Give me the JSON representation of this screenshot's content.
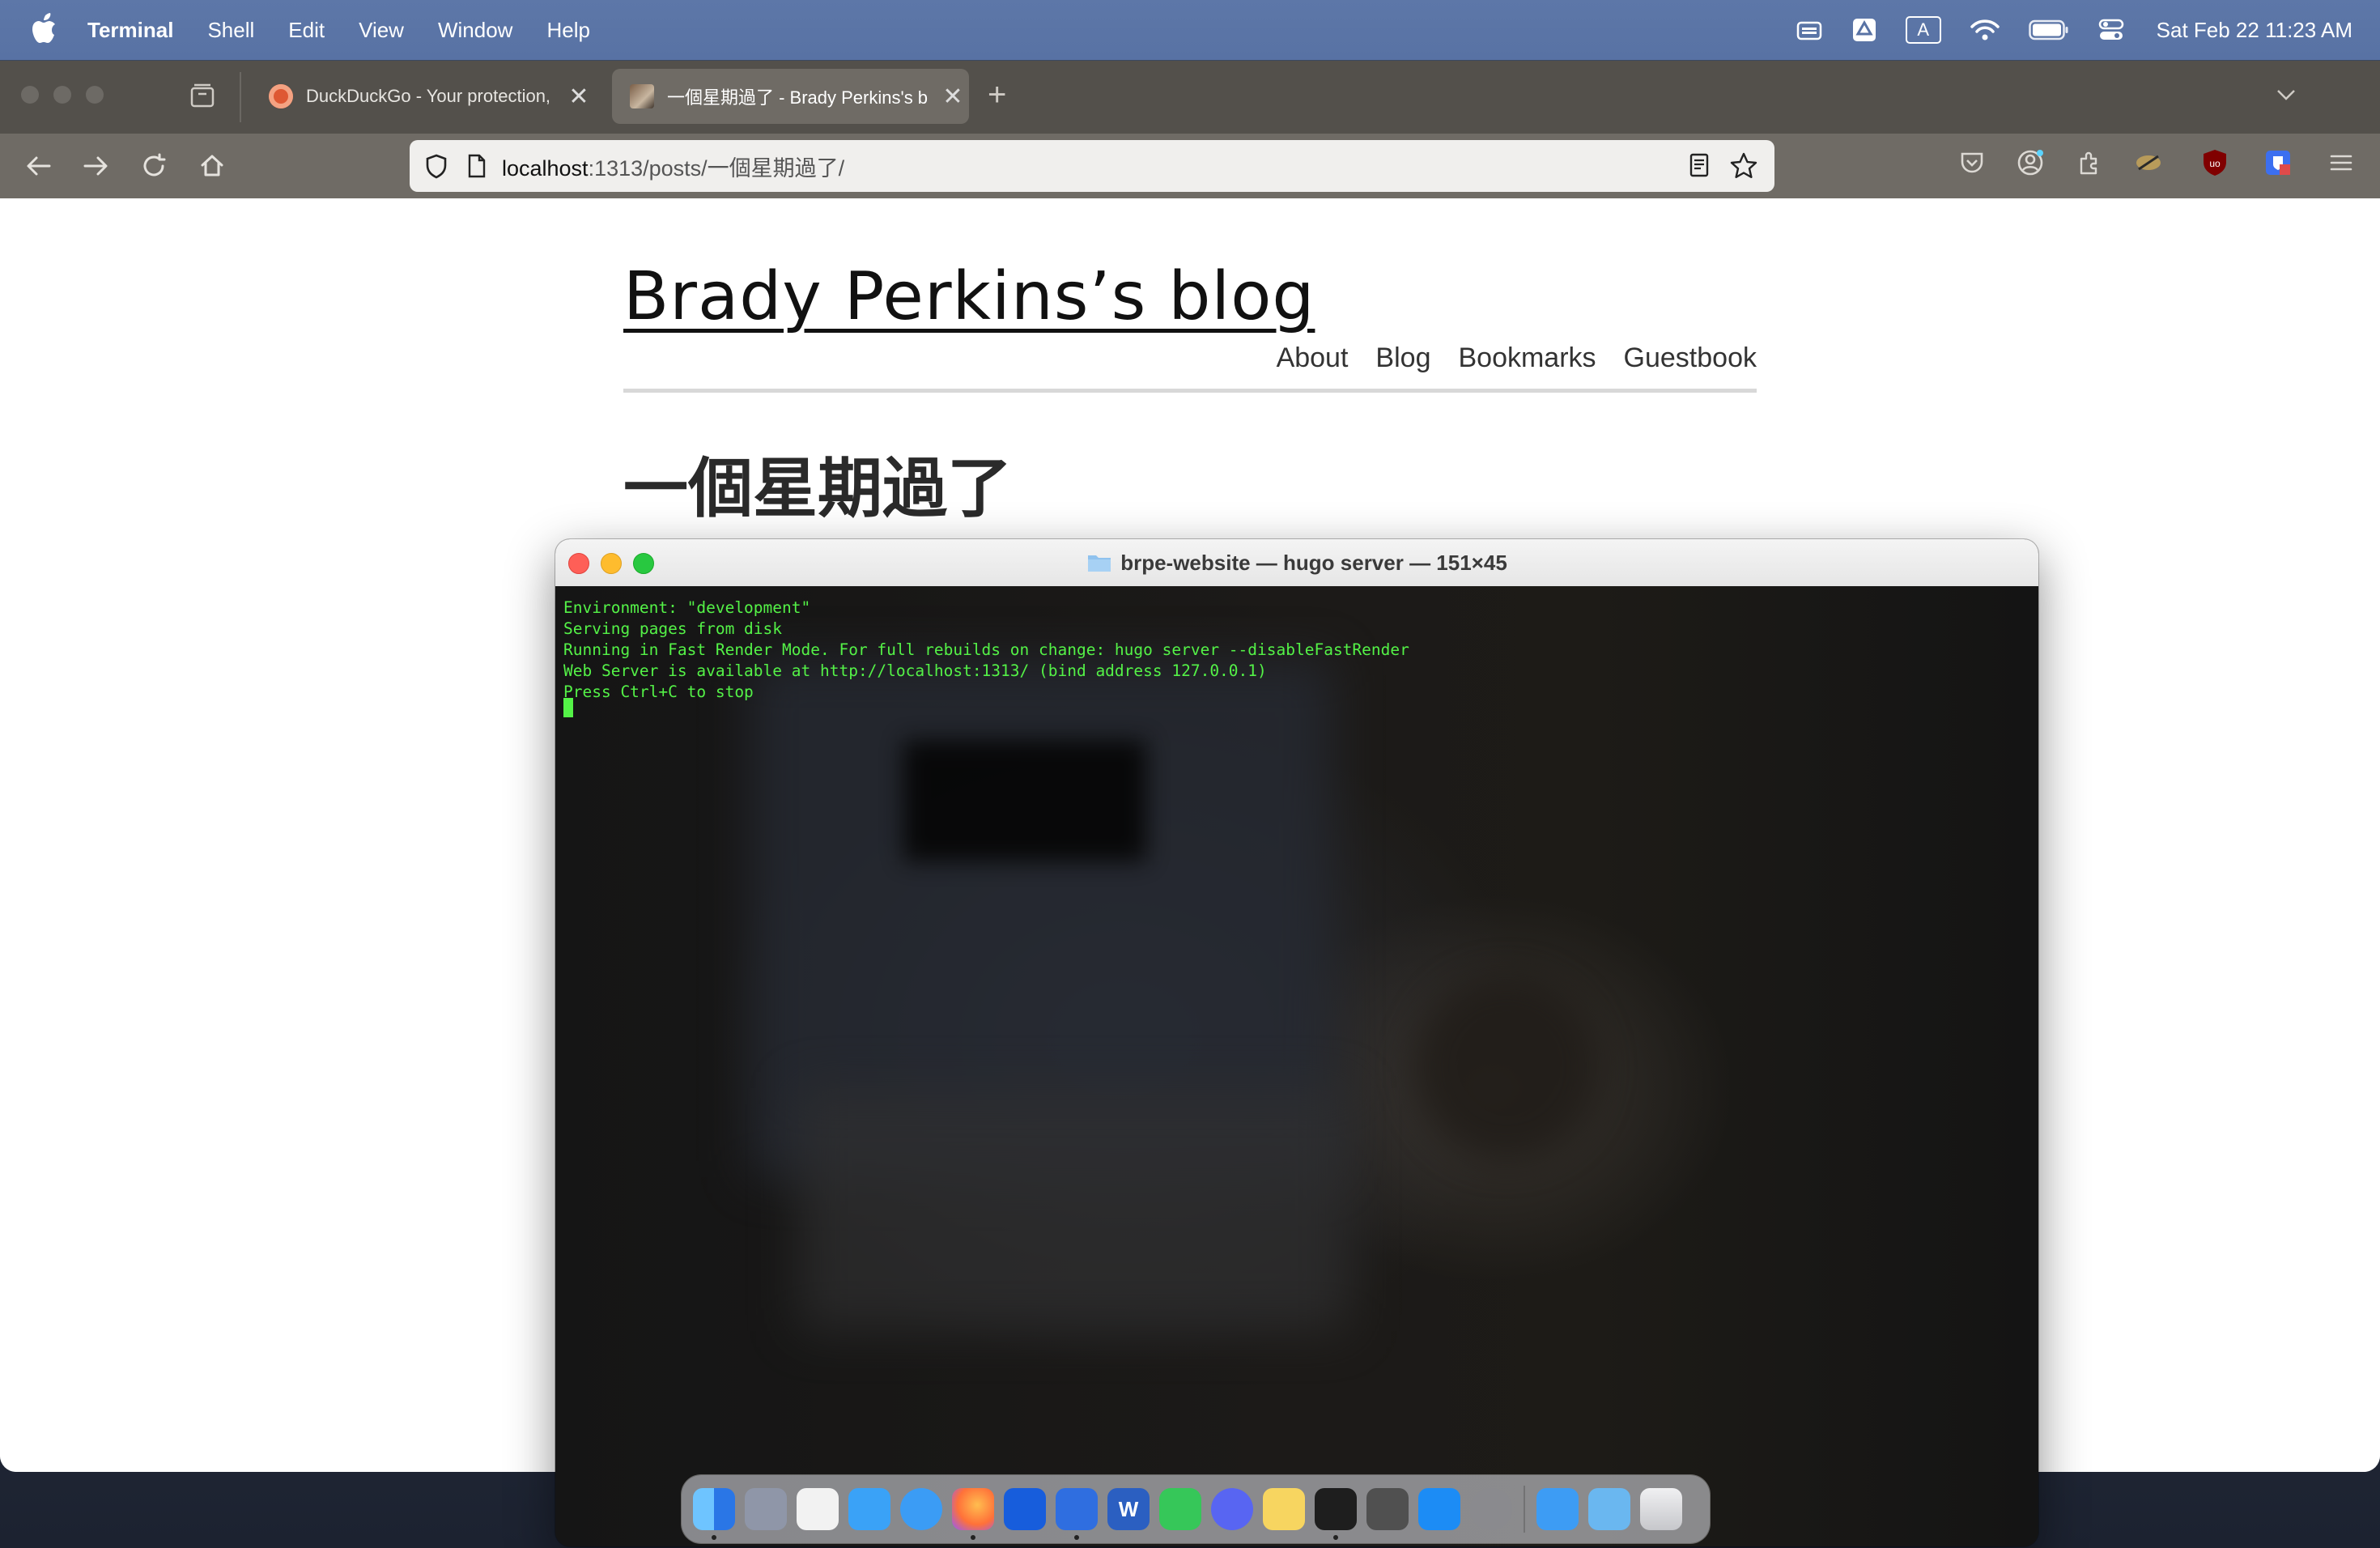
{
  "menubar": {
    "app_name": "Terminal",
    "menus": [
      "Shell",
      "Edit",
      "View",
      "Window",
      "Help"
    ],
    "clock": "Sat Feb 22  11:23 AM",
    "input_source": "A"
  },
  "browser": {
    "tabs": [
      {
        "title": "DuckDuckGo - Your protection,"
      },
      {
        "title": "一個星期過了 - Brady Perkins's b"
      }
    ],
    "url_host": "localhost",
    "url_path": ":1313/posts/一個星期過了/",
    "ext_badge": "uo"
  },
  "blog": {
    "site_title": "Brady Perkins’s blog",
    "nav": [
      "About",
      "Blog",
      "Bookmarks",
      "Guestbook"
    ],
    "post_title": "一個星期過了"
  },
  "terminal": {
    "title": "brpe-website — hugo server — 151×45",
    "lines": [
      "Environment: \"development\"",
      "Serving pages from disk",
      "Running in Fast Render Mode. For full rebuilds on change: hugo server --disableFastRender",
      "Web Server is available at http://localhost:1313/ (bind address 127.0.0.1)",
      "Press Ctrl+C to stop"
    ],
    "text_color": "#54f247"
  },
  "dock": {
    "apps": [
      {
        "name": "finder",
        "glyph": "",
        "color": "#3d8bf5",
        "running": true
      },
      {
        "name": "launchpad",
        "glyph": "",
        "color": "#8f96a8",
        "running": false
      },
      {
        "name": "calendar",
        "glyph": "",
        "color": "#f2f2f2",
        "running": false
      },
      {
        "name": "mail",
        "glyph": "",
        "color": "#3aa2f7",
        "running": false
      },
      {
        "name": "safari",
        "glyph": "",
        "color": "#3b9cf5",
        "running": false
      },
      {
        "name": "firefox",
        "glyph": "",
        "color": "#ff7139",
        "running": true
      },
      {
        "name": "bitwarden",
        "glyph": "",
        "color": "#175ddc",
        "running": false
      },
      {
        "name": "tasks",
        "glyph": "",
        "color": "#2f6ee0",
        "running": true
      },
      {
        "name": "word",
        "glyph": "W",
        "color": "#2b5fc1",
        "running": false
      },
      {
        "name": "messages",
        "glyph": "",
        "color": "#36c759",
        "running": false
      },
      {
        "name": "discord",
        "glyph": "",
        "color": "#5865f2",
        "running": false
      },
      {
        "name": "notes",
        "glyph": "",
        "color": "#f7d560",
        "running": false
      },
      {
        "name": "terminal",
        "glyph": "",
        "color": "#1e1e1e",
        "running": true
      },
      {
        "name": "calculator",
        "glyph": "",
        "color": "#505050",
        "running": false
      },
      {
        "name": "app-store",
        "glyph": "",
        "color": "#1c8cf5",
        "running": false
      },
      {
        "name": "system-settings",
        "glyph": "",
        "color": "#8a8a8e",
        "running": false
      }
    ],
    "stack_apps": [
      {
        "name": "app-store-folder",
        "glyph": "",
        "color": "#3d9cf4"
      },
      {
        "name": "downloads-folder",
        "glyph": "",
        "color": "#6ab7f0"
      },
      {
        "name": "trash",
        "glyph": "",
        "color": "#d9dadd"
      }
    ]
  }
}
